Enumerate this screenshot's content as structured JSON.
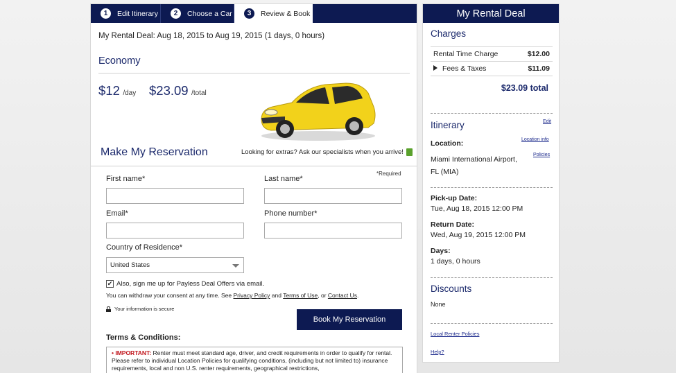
{
  "steps": [
    {
      "num": "1",
      "label": "Edit Itinerary"
    },
    {
      "num": "2",
      "label": "Choose a Car"
    },
    {
      "num": "3",
      "label": "Review & Book"
    }
  ],
  "main": {
    "deal_line": "My Rental Deal: Aug 18, 2015 to Aug 19, 2015 (1 days, 0 hours)",
    "car_class": "Economy",
    "price_day": "$12",
    "price_day_unit": "/day",
    "price_total": "$23.09",
    "price_total_unit": "/total",
    "reserve_title": "Make My Reservation",
    "extras_text": "Looking for extras? Ask our specialists when you arrive!",
    "required_note": "*Required",
    "form": {
      "first_name_label": "First name*",
      "last_name_label": "Last name*",
      "email_label": "Email*",
      "phone_label": "Phone number*",
      "country_label": "Country of Residence*",
      "country_value": "United States",
      "first_name_value": "",
      "last_name_value": "",
      "email_value": "",
      "phone_value": ""
    },
    "optin_text": "Also, sign me up for Payless Deal Offers via email.",
    "optin_checked": true,
    "withdraw_prefix": "You can withdraw your consent at any time. See",
    "privacy_link": "Privacy Policy",
    "and_text": "and",
    "terms_link": "Terms of Use",
    "or_text": ", or",
    "contact_link": "Contact Us",
    "period": ".",
    "secure_text": "Your information is secure",
    "book_button": "Book My Reservation",
    "terms_title": "Terms & Conditions:",
    "terms_important": "• IMPORTANT:",
    "terms_body": "Renter must meet standard age, driver, and credit requirements in order to qualify for rental. Please refer to individual Location Policies for qualifying conditions, (including but not limited to) insurance requirements, local and non U.S. renter requirements, geographical restrictions,"
  },
  "side": {
    "header": "My Rental Deal",
    "charges_title": "Charges",
    "charges": [
      {
        "label": "Rental Time Charge",
        "amount": "$12.00"
      },
      {
        "label": "Fees & Taxes",
        "amount": "$11.09"
      }
    ],
    "total": "$23.09 total",
    "itinerary_title": "Itinerary",
    "edit_link": "Edit",
    "location_label": "Location:",
    "location_info_link": "Location info",
    "policies_link": "Policies",
    "location_line1": "Miami International Airport,",
    "location_line2": "FL (MIA)",
    "pickup_label": "Pick-up Date:",
    "pickup_value": "Tue, Aug 18, 2015 12:00 PM",
    "return_label": "Return Date:",
    "return_value": "Wed, Aug 19, 2015 12:00 PM",
    "days_label": "Days:",
    "days_value": "1 days, 0 hours",
    "discounts_title": "Discounts",
    "discounts_value": "None",
    "local_policies_link": "Local Renter Policies",
    "help_link": "Help?"
  },
  "colors": {
    "navy": "#0d1a52",
    "heading_blue": "#1c2a6c",
    "important_red": "#c0141b",
    "car_yellow": "#f2d21b"
  }
}
